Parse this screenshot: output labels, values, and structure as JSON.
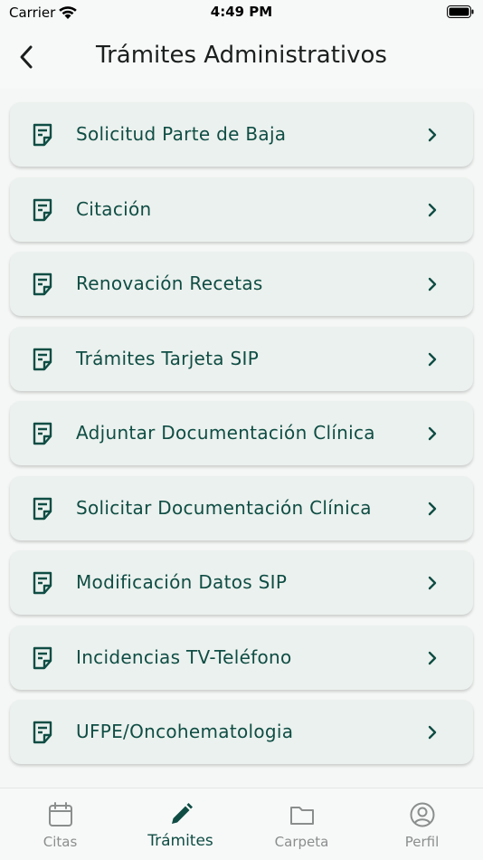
{
  "status_bar": {
    "carrier": "Carrier",
    "time": "4:49 PM"
  },
  "header": {
    "title": "Trámites Administrativos"
  },
  "items": [
    {
      "label": "Solicitud Parte de Baja"
    },
    {
      "label": "Citación"
    },
    {
      "label": "Renovación Recetas"
    },
    {
      "label": "Trámites Tarjeta SIP"
    },
    {
      "label": "Adjuntar Documentación Clínica"
    },
    {
      "label": "Solicitar Documentación Clínica"
    },
    {
      "label": "Modificación Datos SIP"
    },
    {
      "label": "Incidencias TV-Teléfono"
    },
    {
      "label": "UFPE/Oncohematologia"
    }
  ],
  "tabbar": {
    "tabs": [
      {
        "label": "Citas",
        "icon": "calendar-icon"
      },
      {
        "label": "Trámites",
        "icon": "pencil-icon",
        "active": true
      },
      {
        "label": "Carpeta",
        "icon": "folder-icon"
      },
      {
        "label": "Perfil",
        "icon": "profile-icon"
      }
    ]
  },
  "colors": {
    "accent": "#0f4d44",
    "card_bg": "#ebf1ee",
    "inactive_tab": "#8a8e8d"
  }
}
